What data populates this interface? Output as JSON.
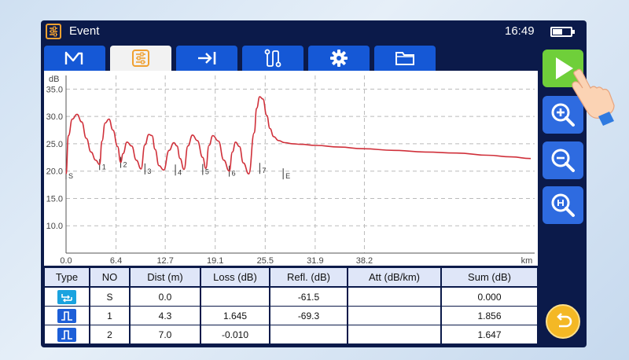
{
  "titlebar": {
    "title": "Event",
    "clock": "16:49",
    "app_icon": "event-list-icon",
    "battery_icon": "battery-icon"
  },
  "tabs": [
    {
      "icon": "trace-icon",
      "active": false
    },
    {
      "icon": "event-list-icon",
      "active": true
    },
    {
      "icon": "arrow-to-end-icon",
      "active": false
    },
    {
      "icon": "route-icon",
      "active": false
    },
    {
      "icon": "gear-icon",
      "active": false
    },
    {
      "icon": "folder-icon",
      "active": false
    }
  ],
  "chart_data": {
    "type": "line",
    "ylabel": "dB",
    "xunit": "km",
    "xlim": [
      0.0,
      60.0
    ],
    "ylim": [
      5.0,
      37.5
    ],
    "xticks": [
      "0.0",
      "6.4",
      "12.7",
      "19.1",
      "25.5",
      "31.9",
      "38.2"
    ],
    "xtick_values": [
      0.0,
      6.4,
      12.7,
      19.1,
      25.5,
      31.9,
      38.2
    ],
    "yticks": [
      "35.0",
      "30.0",
      "25.0",
      "20.0",
      "15.0",
      "10.0"
    ],
    "ytick_values": [
      35.0,
      30.0,
      25.0,
      20.0,
      15.0,
      10.0
    ],
    "grid": true,
    "line_color": "#d0303a",
    "series": [
      {
        "x": [
          0.0,
          0.3,
          0.8,
          1.4,
          2.0,
          2.6,
          3.2,
          3.8,
          4.3,
          4.6,
          5.0,
          5.5,
          6.0,
          6.6,
          7.0,
          7.3,
          7.8,
          8.4,
          9.0,
          9.6,
          10.1,
          10.6,
          11.0,
          11.4,
          11.9,
          12.5,
          13.2,
          13.8,
          14.2,
          14.6,
          15.1,
          15.6,
          16.2,
          16.8,
          17.5,
          17.9,
          18.3,
          18.8,
          19.5,
          20.2,
          20.9,
          21.3,
          21.7,
          22.2,
          22.7,
          23.4,
          24.1,
          24.4,
          24.8,
          25.2,
          25.7,
          26.1,
          26.6,
          27.2,
          28.0,
          29.0,
          30.0,
          32.0,
          35.0,
          38.0,
          42.0,
          46.0,
          50.0,
          54.0,
          57.0,
          59.5
        ],
        "y": [
          19.5,
          26.5,
          29.5,
          30.4,
          29.0,
          26.0,
          23.5,
          22.0,
          21.2,
          25.5,
          28.8,
          29.5,
          27.5,
          24.5,
          21.6,
          23.2,
          25.3,
          24.6,
          22.0,
          20.4,
          24.8,
          26.7,
          26.5,
          24.0,
          21.0,
          20.2,
          23.8,
          25.2,
          24.6,
          22.3,
          20.3,
          24.6,
          26.6,
          25.6,
          22.5,
          20.5,
          24.7,
          26.5,
          25.5,
          22.0,
          20.0,
          23.5,
          25.3,
          24.5,
          21.5,
          19.5,
          27.0,
          31.5,
          33.6,
          33.2,
          30.2,
          27.8,
          26.3,
          25.6,
          25.2,
          25.0,
          24.9,
          24.7,
          24.4,
          24.1,
          23.8,
          23.5,
          23.3,
          22.9,
          22.6,
          22.3
        ]
      }
    ],
    "events": [
      {
        "label": "S",
        "x": 0.0,
        "y": 19.5
      },
      {
        "label": "1",
        "x": 4.3,
        "y": 21.2
      },
      {
        "label": "2",
        "x": 7.0,
        "y": 21.6
      },
      {
        "label": "3",
        "x": 10.1,
        "y": 20.4
      },
      {
        "label": "4",
        "x": 14.0,
        "y": 20.2
      },
      {
        "label": "5",
        "x": 17.5,
        "y": 20.3
      },
      {
        "label": "6",
        "x": 20.9,
        "y": 20.0
      },
      {
        "label": "7",
        "x": 24.8,
        "y": 20.5
      },
      {
        "label": "E",
        "x": 27.8,
        "y": 19.5
      }
    ]
  },
  "event_table": {
    "headers": [
      "Type",
      "NO",
      "Dist (m)",
      "Loss (dB)",
      "Refl. (dB)",
      "Att (dB/km)",
      "Sum (dB)"
    ],
    "rows": [
      {
        "type_icon": "start-event-icon",
        "no": "S",
        "dist": "0.0",
        "loss": "",
        "refl": "-61.5",
        "att": "",
        "sum": "0.000"
      },
      {
        "type_icon": "reflective-event-icon",
        "no": "1",
        "dist": "4.3",
        "loss": "1.645",
        "refl": "-69.3",
        "att": "",
        "sum": "1.856"
      },
      {
        "type_icon": "reflective-event-icon",
        "no": "2",
        "dist": "7.0",
        "loss": "-0.010",
        "refl": "",
        "att": "",
        "sum": "1.647"
      }
    ]
  },
  "side_buttons": [
    {
      "icon": "play-icon"
    },
    {
      "icon": "zoom-in-icon"
    },
    {
      "icon": "zoom-out-icon"
    },
    {
      "icon": "zoom-fit-icon"
    }
  ],
  "back_button": {
    "icon": "back-icon"
  },
  "pointer": {
    "icon": "hand-pointer-icon"
  }
}
